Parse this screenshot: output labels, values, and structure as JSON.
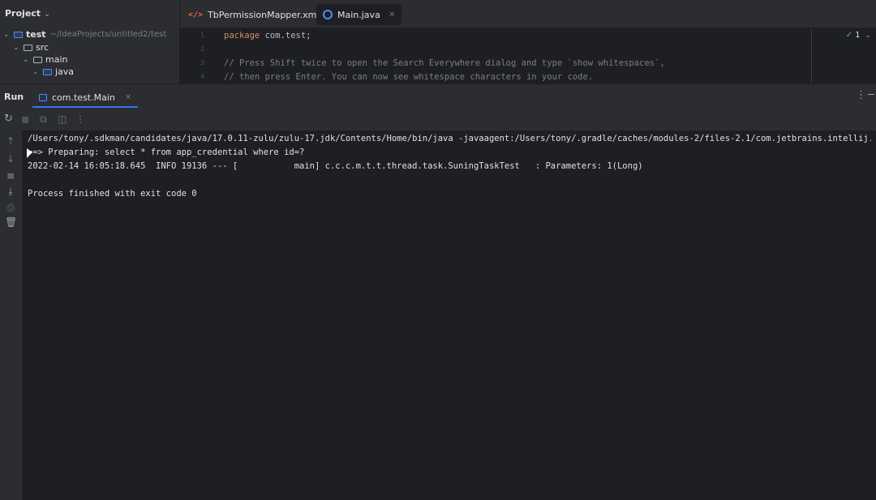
{
  "project": {
    "title": "Project",
    "tree": [
      {
        "label": "test",
        "path": "~/IdeaProjects/untitled2/test"
      },
      {
        "label": "src"
      },
      {
        "label": "main"
      },
      {
        "label": "java"
      }
    ]
  },
  "editor": {
    "tabs": [
      {
        "label": "TbPermissionMapper.xml",
        "icon": "xml-file-icon"
      },
      {
        "label": "Main.java",
        "icon": "java-class-icon",
        "active": true
      }
    ],
    "lines": [
      {
        "no": "1",
        "keyword": "package",
        "text": " com.test;"
      },
      {
        "no": "2",
        "text": ""
      },
      {
        "no": "3",
        "comment": "// Press Shift twice to open the Search Everywhere dialog and type `show whitespaces`,"
      },
      {
        "no": "4",
        "comment": "// then press Enter. You can now see whitespace characters in your code."
      }
    ],
    "inspection_count": "1"
  },
  "run": {
    "title": "Run",
    "config_tab": "com.test.Main",
    "console_lines": [
      "/Users/tony/.sdkman/candidates/java/17.0.11-zulu/zulu-17.jdk/Contents/Home/bin/java -javaagent:/Users/tony/.gradle/caches/modules-2/files-2.1/com.jetbrains.intellij.idea/ide",
      "==> Preparing: select * from app_credential where id=?",
      "2022-02-14 16:05:18.645  INFO 19136 --- [           main] c.c.c.m.t.t.thread.task.SuningTaskTest   : Parameters: 1(Long)",
      "",
      "Process finished with exit code 0"
    ]
  },
  "colors": {
    "background": "#1e1f22",
    "panel": "#2b2d30",
    "keyword": "#cf8e6d",
    "comment": "#7a7e85",
    "accent": "#3574f0"
  }
}
